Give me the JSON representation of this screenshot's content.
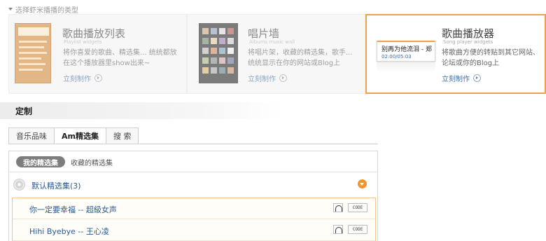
{
  "section_caption": "选择虾米播播的类型",
  "types": [
    {
      "title": "歌曲播放列表",
      "subtitle": "Playlist widgets",
      "desc_line1": "将你喜爱的歌曲、精选集... 统统都放",
      "desc_line2": "在这个播放器里show出来~",
      "link": "立刻制作"
    },
    {
      "title": "唱片墙",
      "subtitle": "Albums music wall",
      "desc_line1": "将唱片架，收藏的精选集，歌手...",
      "desc_line2": "统统显示在你的网站或Blog上",
      "link": "立刻制作"
    },
    {
      "title": "歌曲播放器",
      "subtitle": "Song player widgets",
      "desc_line1": "将歌曲方便的转贴到其它网站、",
      "desc_line2": "论坛或你的Blog上",
      "link": "立刻制作",
      "preview_song": "别再为他流泪 - 郑",
      "preview_time": "02:00/05:03"
    }
  ],
  "customize_title": "定制",
  "tabs": [
    "音乐品味",
    "Am精选集",
    "搜 索"
  ],
  "subtabs": {
    "active": "我的精选集",
    "other": "收藏的精选集"
  },
  "folder": {
    "label": "默认精选集(3)"
  },
  "songs": [
    {
      "title": "你一定要幸福 -- 超級女声",
      "code_label": "CODE"
    },
    {
      "title": "Hihi Byebye -- 王心凌",
      "code_label": "CODE"
    }
  ],
  "colors": {
    "accent": "#f0a24a",
    "link": "#2a5a93",
    "pill": "#7d7d7d"
  }
}
